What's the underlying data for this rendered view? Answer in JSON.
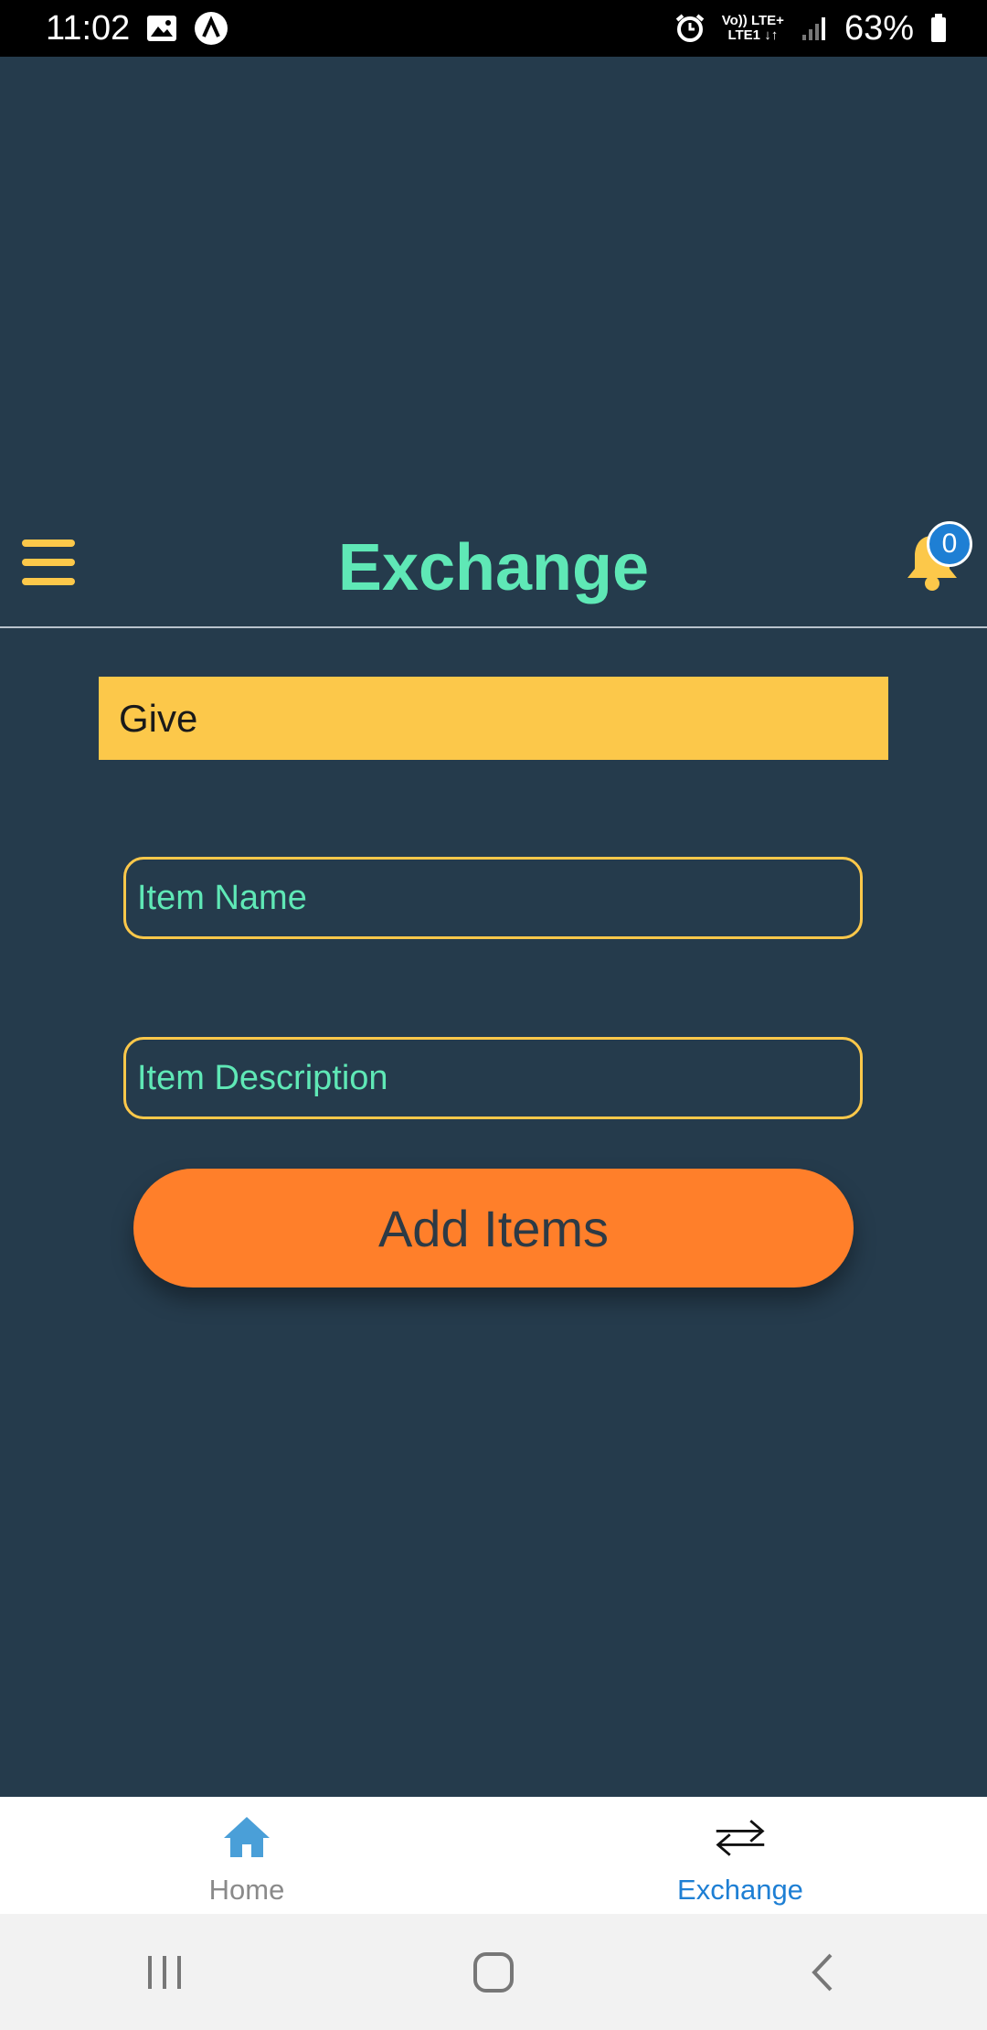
{
  "status_bar": {
    "time": "11:02",
    "network_top": "Vo)) LTE+",
    "network_bottom": "LTE1 ↓↑",
    "battery": "63%"
  },
  "header": {
    "title": "Exchange",
    "notification_count": "0"
  },
  "form": {
    "section_label": "Give",
    "item_name_placeholder": "Item Name",
    "item_description_placeholder": "Item Description",
    "submit_label": "Add Items"
  },
  "tabs": [
    {
      "label": "Home",
      "icon": "home-icon",
      "active": false
    },
    {
      "label": "Exchange",
      "icon": "exchange-icon",
      "active": true
    }
  ],
  "colors": {
    "background": "#253B4C",
    "accent_yellow": "#FCC84A",
    "accent_green": "#5FE8B6",
    "button_orange": "#FF7F2A",
    "active_tab": "#1E7FD4"
  }
}
